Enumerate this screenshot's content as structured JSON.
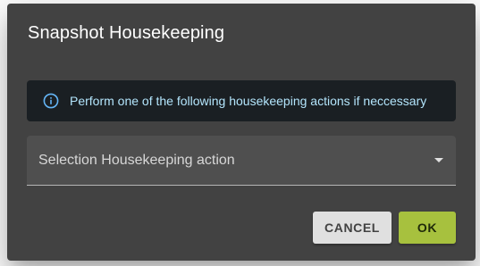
{
  "dialog": {
    "title": "Snapshot Housekeeping",
    "alert": {
      "icon": "info-icon",
      "text": "Perform one of the following housekeeping actions if neccessary"
    },
    "select": {
      "label": "Selection Housekeeping action",
      "icon": "caret-down-icon"
    },
    "buttons": {
      "cancel_label": "CANCEL",
      "ok_label": "OK"
    }
  },
  "colors": {
    "dialog_background": "#424242",
    "alert_background": "#1a1f23",
    "alert_text": "#b3e5fc",
    "ok_button": "#a7c13e",
    "cancel_button": "#e0e0e0"
  }
}
